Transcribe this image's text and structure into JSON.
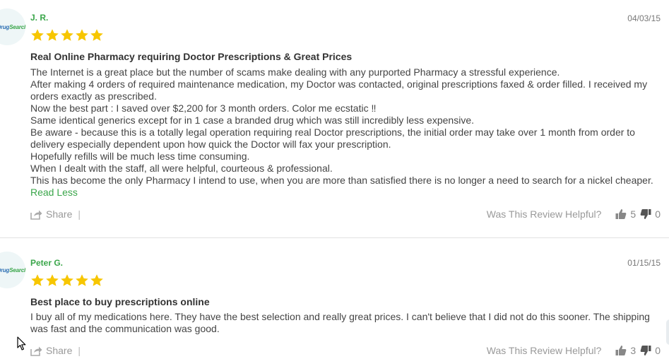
{
  "brand": {
    "logo_text": "DrugSearch"
  },
  "reviews": [
    {
      "name": "J. R.",
      "date": "04/03/15",
      "rating": 5,
      "title": "Real Online Pharmacy requiring Doctor Prescriptions & Great Prices",
      "paragraphs": [
        "The Internet is a great place but the number of scams make dealing with any purported Pharmacy a stressful experience.",
        "After making 4 orders of required maintenance medication, my Doctor was contacted, original prescriptions faxed & order filled. I received my orders exactly as prescribed.",
        "Now the best part : I saved over $2,200 for 3 month orders. Color me ecstatic ‼",
        "Same identical generics except for in 1 case a branded drug which was still incredibly less expensive.",
        "Be aware - because this is a totally legal operation requiring real Doctor prescriptions, the initial order may take over 1 month from order to delivery especially dependent upon how quick the Doctor will fax your prescription.",
        "Hopefully refills will be much less time consuming.",
        "When I dealt with the staff, all were helpful, courteous & professional.",
        "This has become the only Pharmacy I intend to use, when you are more than satisfied there is no longer a need to search for a nickel cheaper."
      ],
      "read_less": "Read Less",
      "share_label": "Share",
      "separator": "|",
      "helpful_label": "Was This Review Helpful?",
      "upvotes": "5",
      "downvotes": "0"
    },
    {
      "name": "Peter G.",
      "date": "01/15/15",
      "rating": 5,
      "title": "Best place to buy prescriptions online",
      "paragraphs": [
        "I buy all of my medications here. They have the best selection and really great prices. I can't believe that I did not do this sooner. The shipping was fast and the communication was good."
      ],
      "share_label": "Share",
      "separator": "|",
      "helpful_label": "Was This Review Helpful?",
      "upvotes": "3",
      "downvotes": "0"
    }
  ],
  "colors": {
    "accent_green": "#3aa64a",
    "star_gold": "#f7c600",
    "muted_text": "#999999"
  },
  "icons": [
    "star-icon",
    "share-icon",
    "thumbs-up-icon",
    "thumbs-down-icon",
    "mouse-cursor-icon"
  ]
}
